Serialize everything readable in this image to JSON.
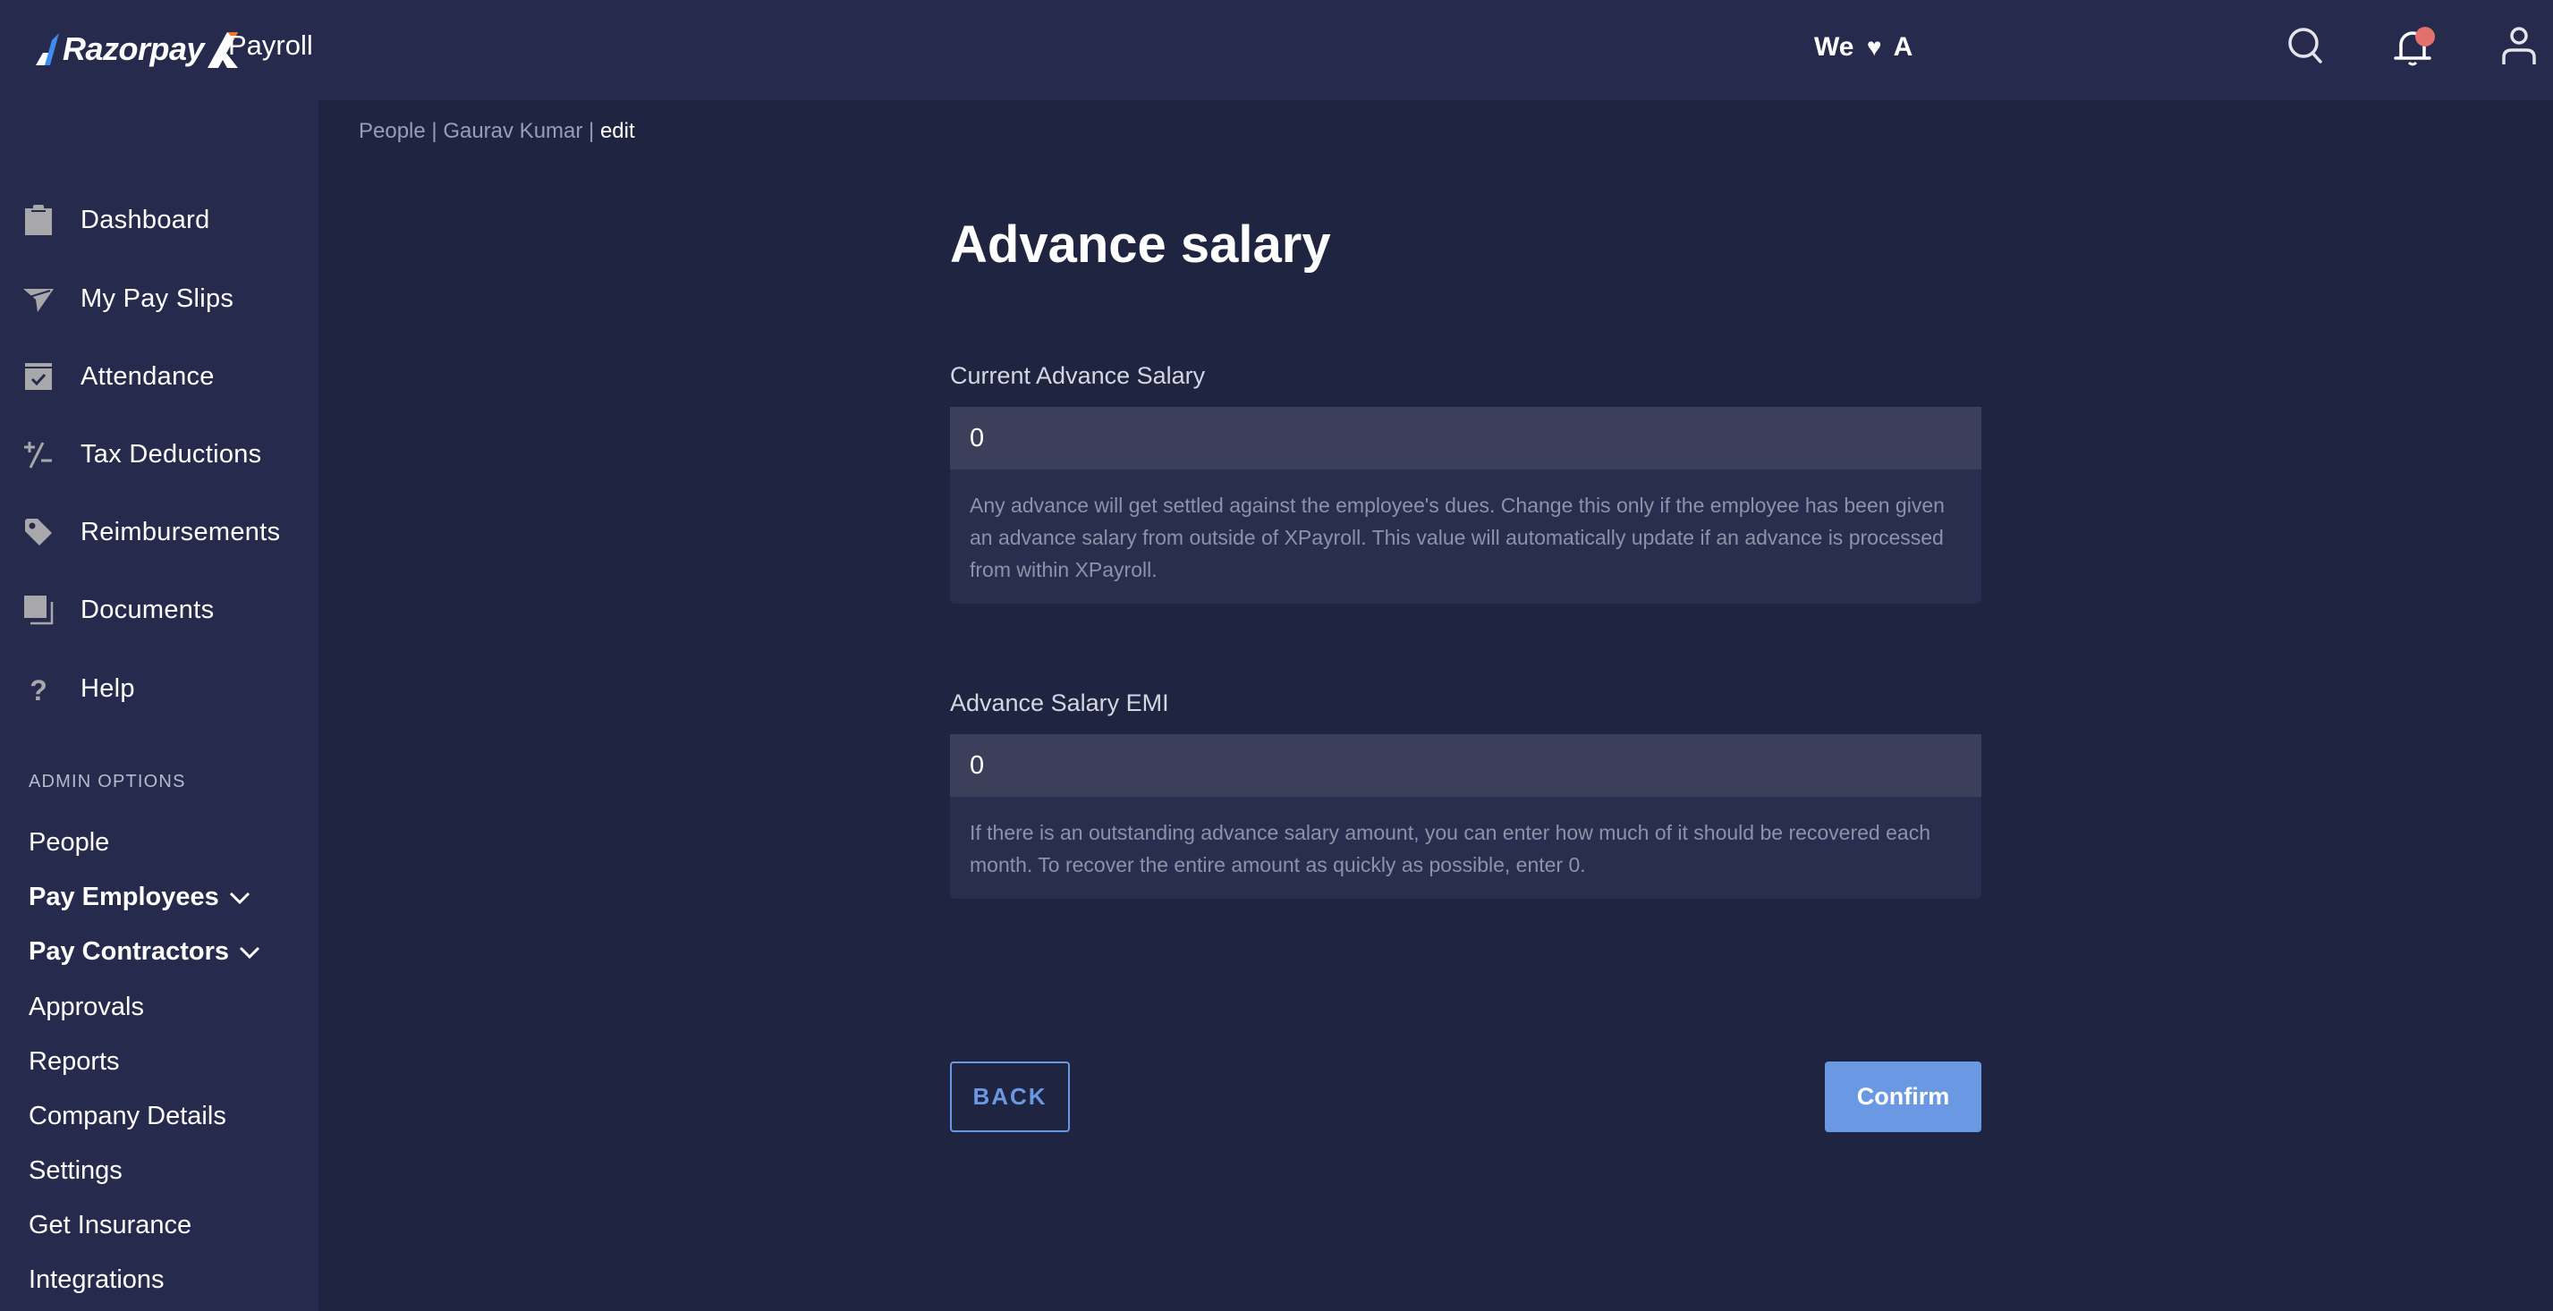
{
  "header": {
    "brand": "Razorpay",
    "brand_suffix_icon": "x-logo-icon",
    "product": "Payroll",
    "tagline_before": "We",
    "tagline_heart": "♥",
    "tagline_after": "A",
    "icons": [
      "search-icon",
      "bell-icon",
      "user-icon"
    ],
    "notification_dot_color": "#e2706c"
  },
  "sidebar": {
    "items": [
      {
        "label": "Dashboard",
        "icon": "clipboard-icon"
      },
      {
        "label": "My Pay Slips",
        "icon": "paper-plane-icon"
      },
      {
        "label": "Attendance",
        "icon": "calendar-check-icon"
      },
      {
        "label": "Tax Deductions",
        "icon": "plus-minus-icon"
      },
      {
        "label": "Reimbursements",
        "icon": "tag-icon"
      },
      {
        "label": "Documents",
        "icon": "documents-icon"
      },
      {
        "label": "Help",
        "icon": "question-icon"
      }
    ],
    "admin_heading": "ADMIN OPTIONS",
    "admin_items": [
      {
        "label": "People"
      },
      {
        "label": "Pay Employees",
        "expandable": true
      },
      {
        "label": "Pay Contractors",
        "expandable": true
      },
      {
        "label": "Approvals"
      },
      {
        "label": "Reports"
      },
      {
        "label": "Company Details"
      },
      {
        "label": "Settings"
      },
      {
        "label": "Get Insurance"
      },
      {
        "label": "Integrations"
      }
    ]
  },
  "breadcrumb": {
    "items": [
      "People",
      "Gaurav Kumar"
    ],
    "separator": " | ",
    "current": "edit"
  },
  "form": {
    "title": "Advance salary",
    "fields": [
      {
        "label": "Current Advance Salary",
        "value": "0",
        "help": "Any advance will get settled against the employee's dues. Change this only if the employee has been given an advance salary from outside of XPayroll. This value will automatically update if an advance is processed from within XPayroll."
      },
      {
        "label": "Advance Salary EMI",
        "value": "0",
        "help": "If there is an outstanding advance salary amount, you can enter how much of it should be recovered each month. To recover the entire amount as quickly as possible, enter 0."
      }
    ],
    "back_label": "BACK",
    "confirm_label": "Confirm"
  },
  "colors": {
    "header_bg": "#262b4d",
    "main_bg": "#1f2441",
    "accent": "#6a98e2",
    "input_bg": "#3b3f5a",
    "helper_bg": "#292e4e"
  }
}
